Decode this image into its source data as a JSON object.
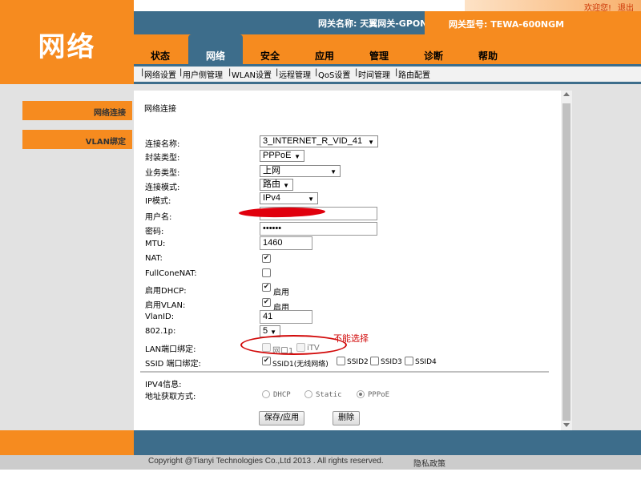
{
  "top_links": {
    "welcome": "欢迎您!",
    "logout": "退出"
  },
  "brand": "网络",
  "gateway": {
    "name": "网关名称: 天翼网关-GPON",
    "model": "网关型号: TEWA-600NGM"
  },
  "tabs": [
    "状态",
    "网络",
    "安全",
    "应用",
    "管理",
    "诊断",
    "帮助"
  ],
  "active_tab": "网络",
  "subnav": [
    "网络设置",
    "用户侧管理",
    "WLAN设置",
    "远程管理",
    "QoS设置",
    "时间管理",
    "路由配置"
  ],
  "sidebar": [
    "网络连接",
    "VLAN绑定"
  ],
  "section_title": "网络连接",
  "form": {
    "labels": {
      "conn_name": "连接名称:",
      "encap": "封装类型:",
      "service": "业务类型:",
      "conn_mode": "连接模式:",
      "ip_mode": "IP模式:",
      "username": "用户名:",
      "password": "密码:",
      "mtu": "MTU:",
      "nat": "NAT:",
      "fullcone": "FullConeNAT:",
      "dhcp": "启用DHCP:",
      "vlan": "启用VLAN:",
      "vlanid": "VlanID:",
      "p8021": "802.1p:",
      "lan_bind": "LAN端口绑定:",
      "ssid_bind": "SSID 端口绑定:"
    },
    "values": {
      "conn_name": "3_INTERNET_R_VID_41",
      "encap": "PPPoE",
      "service": "上网",
      "conn_mode": "路由",
      "ip_mode": "IPv4",
      "username": "",
      "password": "••••••",
      "mtu": "1460",
      "vlanid": "41",
      "p8021": "5"
    },
    "check_labels": {
      "enabled": "启用",
      "lan1": "网口1",
      "itv": "iTV",
      "ssid1": "SSID1(无线网络)",
      "ssid2": "SSID2",
      "ssid3": "SSID3",
      "ssid4": "SSID4"
    },
    "checks": {
      "nat": true,
      "fullcone": false,
      "dhcp": true,
      "vlan": true,
      "lan1": false,
      "itv": false,
      "ssid1": true,
      "ssid2": false,
      "ssid3": false,
      "ssid4": false
    },
    "ipv4_title": "IPV4信息:",
    "addr_label": "地址获取方式:",
    "addr_options": [
      "DHCP",
      "Static",
      "PPPoE"
    ],
    "addr_selected": "PPPoE",
    "buttons": {
      "save": "保存/应用",
      "delete": "删除"
    }
  },
  "annotation": "不能选择",
  "footer": {
    "copyright": "Copyright @Tianyi Technologies Co.,Ltd 2013 . All rights reserved.",
    "privacy": "隐私政策"
  },
  "colors": {
    "orange": "#f68b1f",
    "blue": "#3d6d8b",
    "annotation_red": "#d20a0a"
  }
}
